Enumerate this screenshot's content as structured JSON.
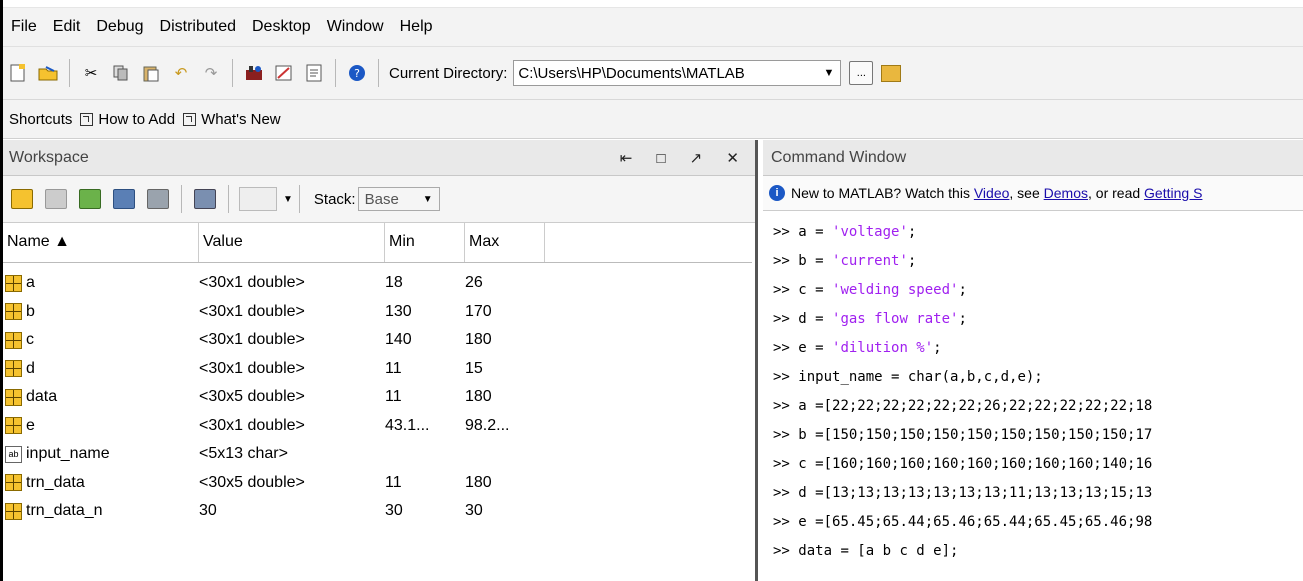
{
  "menu": [
    "File",
    "Edit",
    "Debug",
    "Distributed",
    "Desktop",
    "Window",
    "Help"
  ],
  "toolbar": {
    "current_directory_label": "Current Directory:",
    "current_directory_value": "C:\\Users\\HP\\Documents\\MATLAB",
    "browse_label": "..."
  },
  "shortcuts": {
    "label": "Shortcuts",
    "how_to_add": "How to Add",
    "whats_new": "What's New"
  },
  "workspace": {
    "title": "Workspace",
    "window_controls": "⇤ □ ↗ ✕",
    "stack_label": "Stack:",
    "stack_value": "Base",
    "columns": [
      "Name ▲",
      "Value",
      "Min",
      "Max"
    ],
    "rows": [
      {
        "name": "a",
        "value": "<30x1 double>",
        "min": "18",
        "max": "26",
        "type": "double"
      },
      {
        "name": "b",
        "value": "<30x1 double>",
        "min": "130",
        "max": "170",
        "type": "double"
      },
      {
        "name": "c",
        "value": "<30x1 double>",
        "min": "140",
        "max": "180",
        "type": "double"
      },
      {
        "name": "d",
        "value": "<30x1 double>",
        "min": "11",
        "max": "15",
        "type": "double"
      },
      {
        "name": "data",
        "value": "<30x5 double>",
        "min": "11",
        "max": "180",
        "type": "double"
      },
      {
        "name": "e",
        "value": "<30x1 double>",
        "min": "43.1...",
        "max": "98.2...",
        "type": "double"
      },
      {
        "name": "input_name",
        "value": "<5x13 char>",
        "min": "",
        "max": "",
        "type": "char"
      },
      {
        "name": "trn_data",
        "value": "<30x5 double>",
        "min": "11",
        "max": "180",
        "type": "double"
      },
      {
        "name": "trn_data_n",
        "value": "30",
        "min": "30",
        "max": "30",
        "type": "double"
      }
    ]
  },
  "command_window": {
    "title": "Command Window",
    "info_prefix": "New to MATLAB? Watch this ",
    "info_video": "Video",
    "info_mid": ", see ",
    "info_demos": "Demos",
    "info_mid2": ", or read ",
    "info_getting": "Getting S",
    "lines": [
      {
        "prompt": ">> ",
        "code": "a = ",
        "str": "'voltage'",
        "tail": ";"
      },
      {
        "prompt": ">> ",
        "code": "b = ",
        "str": "'current'",
        "tail": ";"
      },
      {
        "prompt": ">> ",
        "code": "c = ",
        "str": "'welding speed'",
        "tail": ";"
      },
      {
        "prompt": ">> ",
        "code": "d = ",
        "str": "'gas flow rate'",
        "tail": ";"
      },
      {
        "prompt": ">> ",
        "code": "e = ",
        "str": "'dilution %'",
        "tail": ";"
      },
      {
        "prompt": ">> ",
        "code": "input_name = char(a,b,c,d,e);",
        "str": "",
        "tail": ""
      },
      {
        "prompt": ">> ",
        "code": "a =[22;22;22;22;22;22;26;22;22;22;22;22;18",
        "str": "",
        "tail": ""
      },
      {
        "prompt": ">> ",
        "code": "b =[150;150;150;150;150;150;150;150;150;17",
        "str": "",
        "tail": ""
      },
      {
        "prompt": ">> ",
        "code": "c =[160;160;160;160;160;160;160;160;140;16",
        "str": "",
        "tail": ""
      },
      {
        "prompt": ">> ",
        "code": "d =[13;13;13;13;13;13;13;11;13;13;13;15;13",
        "str": "",
        "tail": ""
      },
      {
        "prompt": ">> ",
        "code": "e =[65.45;65.44;65.46;65.44;65.45;65.46;98",
        "str": "",
        "tail": ""
      },
      {
        "prompt": ">> ",
        "code": "data = [a b c d e];",
        "str": "",
        "tail": ""
      }
    ]
  }
}
